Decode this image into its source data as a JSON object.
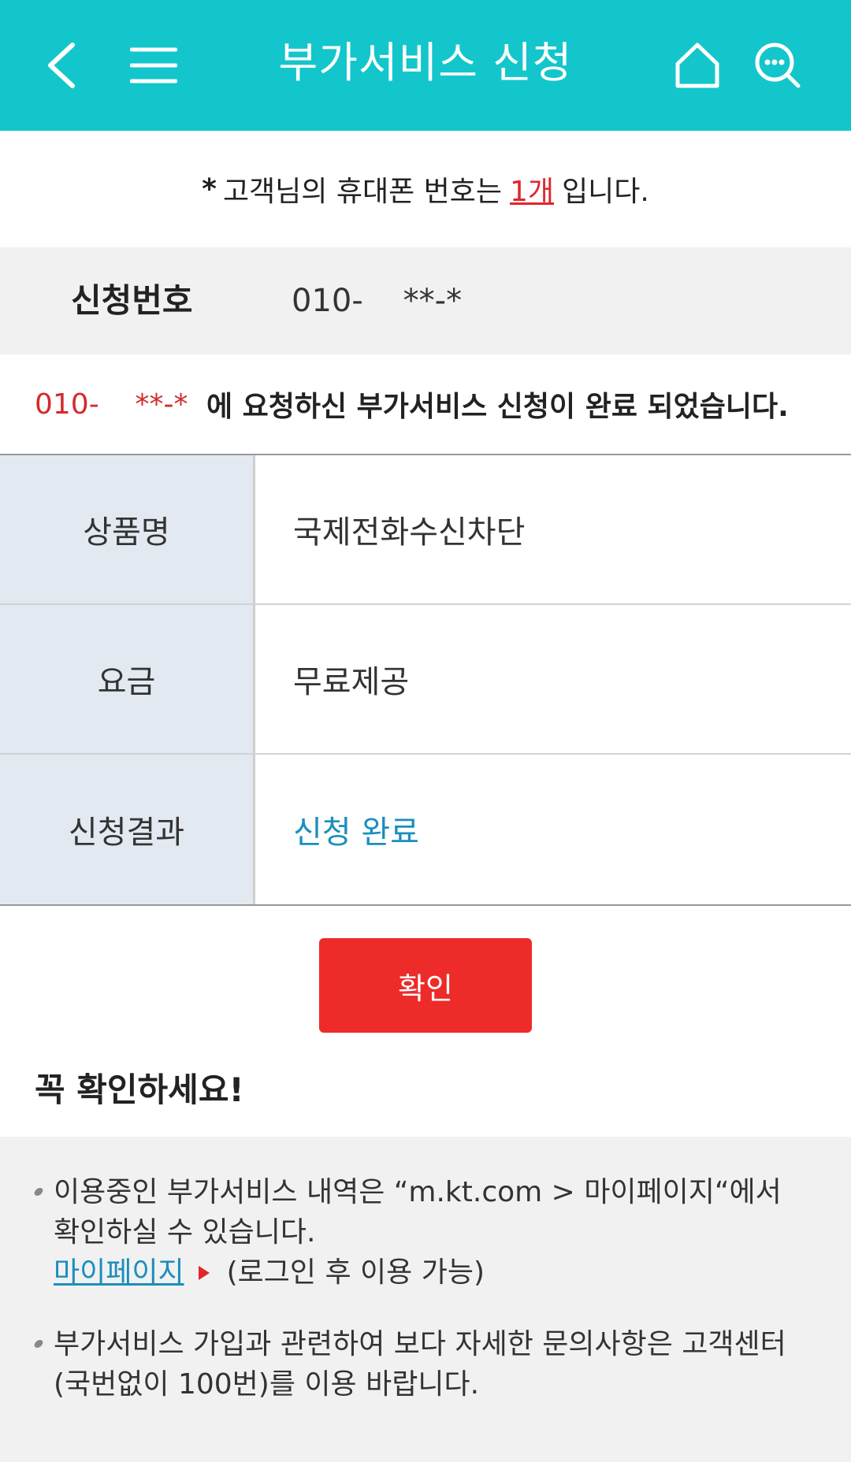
{
  "header": {
    "title": "부가서비스 신청",
    "icons": [
      "back-arrow-icon",
      "menu-icon",
      "home-icon",
      "chat-search-icon"
    ],
    "bg_color": "#13c6cb"
  },
  "notice": {
    "star": "*",
    "prefix": "고객님의 휴대폰 번호는",
    "count": "1개",
    "suffix": "입니다."
  },
  "request": {
    "label": "신청번호",
    "number": "010-    **-*"
  },
  "completion": {
    "number": "010-    **-*",
    "message": "에 요청하신 부가서비스 신청이 완료 되었습니다."
  },
  "table": {
    "rows": [
      {
        "label": "상품명",
        "value": "국제전화수신차단"
      },
      {
        "label": "요금",
        "value": "무료제공"
      },
      {
        "label": "신청결과",
        "value": "신청 완료"
      }
    ]
  },
  "confirm_button": {
    "label": "확인",
    "color": "#ed2b28"
  },
  "check": {
    "title": "꼭 확인하세요!",
    "tip1_text": "이용중인 부가서비스 내역은 “m.kt.com > 마이페이지“에서 확인하실 수 있습니다.",
    "tip1_link": "마이페이지",
    "tip1_link_note": "(로그인 후 이용 가능)",
    "tip2_text": "부가서비스 가입과 관련하여 보다 자세한 문의사항은 고객센터(국번없이 100번)를 이용 바랍니다."
  }
}
